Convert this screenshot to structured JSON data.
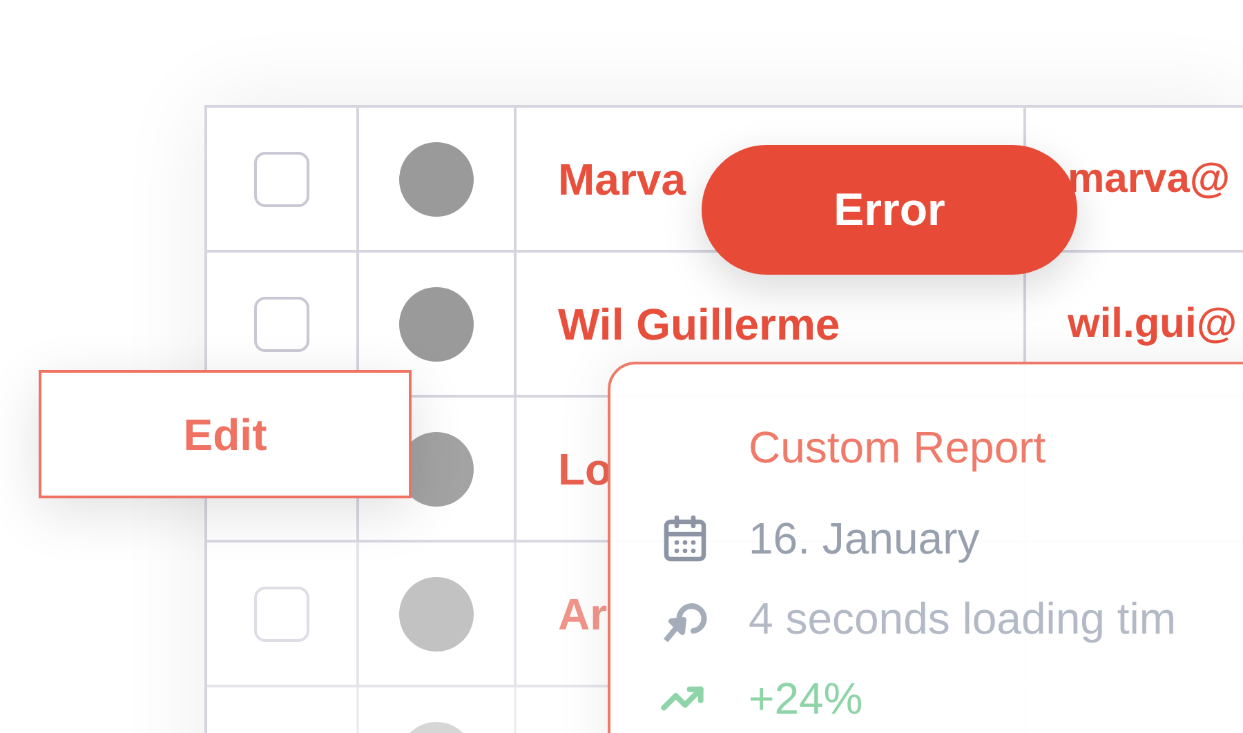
{
  "rows": [
    {
      "checked": false,
      "name": "Marva",
      "email": "marva@"
    },
    {
      "checked": false,
      "name": "Wil Guillerme",
      "email": "wil.gui@"
    },
    {
      "name": "Lo"
    },
    {
      "checked": false,
      "name": "Ar"
    },
    {}
  ],
  "error_badge": "Error",
  "edit_button": "Edit",
  "report_card": {
    "title": "Custom Report",
    "items": [
      {
        "kind": "date",
        "text": "16. January"
      },
      {
        "kind": "loading",
        "text": "4 seconds loading tim"
      },
      {
        "kind": "trend",
        "text": "+24%"
      }
    ]
  }
}
